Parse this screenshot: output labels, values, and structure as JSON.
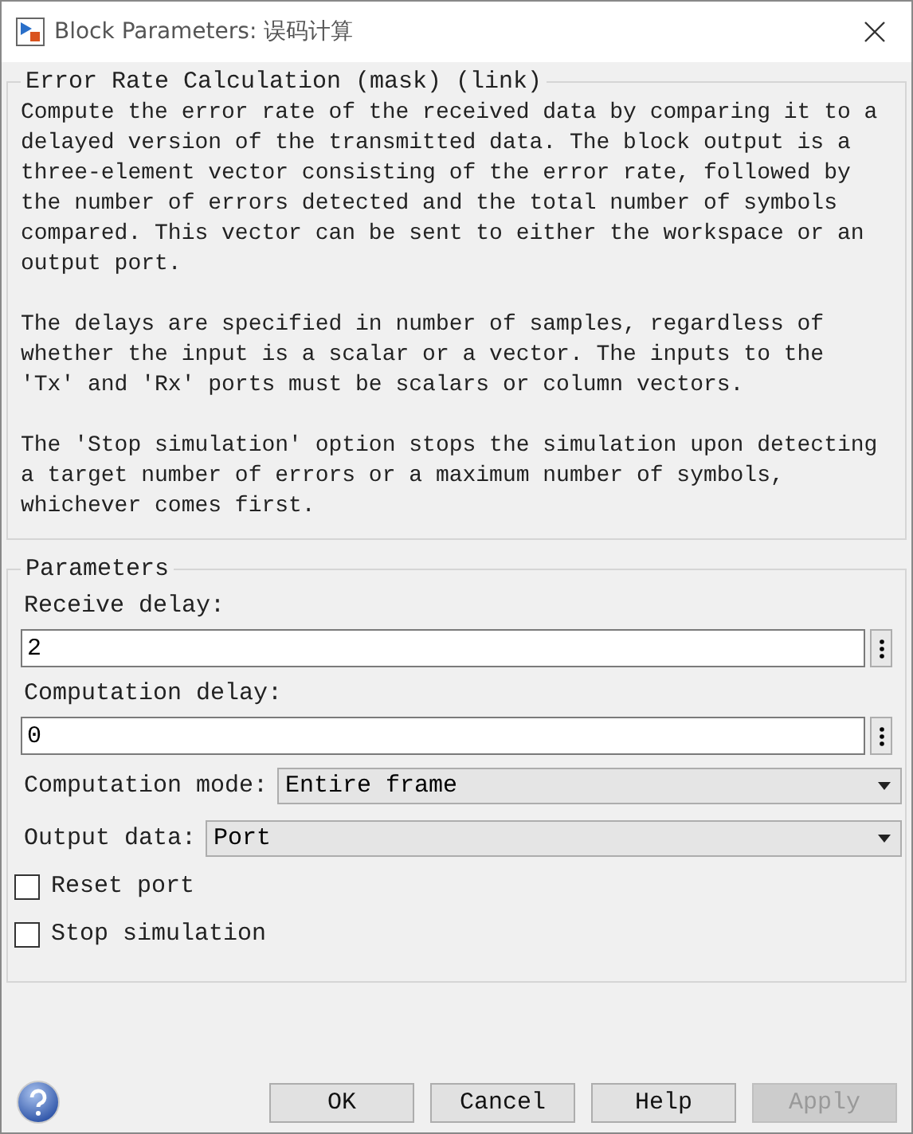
{
  "window": {
    "title": "Block Parameters: 误码计算"
  },
  "description": {
    "title": "Error Rate Calculation (mask) (link)",
    "paragraphs": [
      "Compute the error rate of the received data by comparing it to a\ndelayed version of the transmitted data. The block output is a\nthree-element vector consisting of the error rate, followed by\nthe number of errors detected and the total number of symbols\ncompared. This vector can be sent to either the workspace or an\noutput port.",
      "The delays are specified in number of samples, regardless of\nwhether the input is a scalar or a vector. The inputs to the\n'Tx' and 'Rx' ports must be scalars or column vectors.",
      "The 'Stop simulation' option stops the simulation upon detecting\na target number of errors or a maximum number of symbols,\nwhichever comes first."
    ]
  },
  "parameters": {
    "title": "Parameters",
    "items": [
      {
        "kind": "edit",
        "label": "Receive delay:",
        "value": "2"
      },
      {
        "kind": "edit",
        "label": "Computation delay:",
        "value": "0"
      },
      {
        "kind": "popup",
        "label": "Computation mode:",
        "value": "Entire frame"
      },
      {
        "kind": "popup",
        "label": "Output data:",
        "value": "Port"
      },
      {
        "kind": "check",
        "label": "Reset port",
        "checked": false
      },
      {
        "kind": "check",
        "label": "Stop simulation",
        "checked": false
      }
    ]
  },
  "buttons": [
    {
      "label": "OK",
      "disabled": false
    },
    {
      "label": "Cancel",
      "disabled": false
    },
    {
      "label": "Help",
      "disabled": false
    },
    {
      "label": "Apply",
      "disabled": true
    }
  ]
}
